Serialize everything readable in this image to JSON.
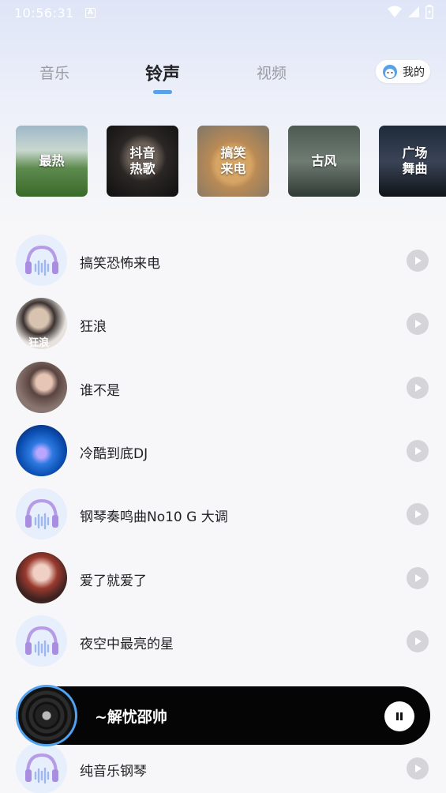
{
  "status_bar": {
    "time": "10:56:31",
    "notification_badge": "A",
    "icons": [
      "wifi-icon",
      "signal-icon",
      "battery-icon"
    ]
  },
  "tabs": [
    {
      "label": "音乐",
      "active": false
    },
    {
      "label": "铃声",
      "active": true
    },
    {
      "label": "视频",
      "active": false
    }
  ],
  "mine_button": {
    "label": "我的",
    "icon": "face-icon"
  },
  "categories": [
    {
      "label": "最热",
      "bg": "landscape-lake"
    },
    {
      "label": "抖音\n热歌",
      "bg": "portrait-dark"
    },
    {
      "label": "搞笑\n来电",
      "bg": "puppy"
    },
    {
      "label": "古风",
      "bg": "ancient-bridge"
    },
    {
      "label": "广场\n舞曲",
      "bg": "dance-stage"
    }
  ],
  "songs": [
    {
      "title": "搞笑恐怖来电",
      "cover": "headphones-icon"
    },
    {
      "title": "狂浪",
      "cover": "portrait-sunglasses",
      "cover_text": "狂浪"
    },
    {
      "title": "谁不是",
      "cover": "portrait-woman"
    },
    {
      "title": "冷酷到底DJ",
      "cover": "blue-stage"
    },
    {
      "title": "钢琴奏鸣曲No10 G 大调",
      "cover": "headphones-icon"
    },
    {
      "title": "爱了就爱了",
      "cover": "portrait-redhair"
    },
    {
      "title": "夜空中最亮的星",
      "cover": "headphones-icon"
    },
    {
      "title": "纯音乐钢琴",
      "cover": "headphones-icon"
    }
  ],
  "player": {
    "now_playing": "~解忧邵帅",
    "state": "playing",
    "accent": "#4fa3f2"
  },
  "colors": {
    "accent": "#5aa0e6",
    "play_button": "#d5d5d9",
    "player_bg": "#050505"
  }
}
